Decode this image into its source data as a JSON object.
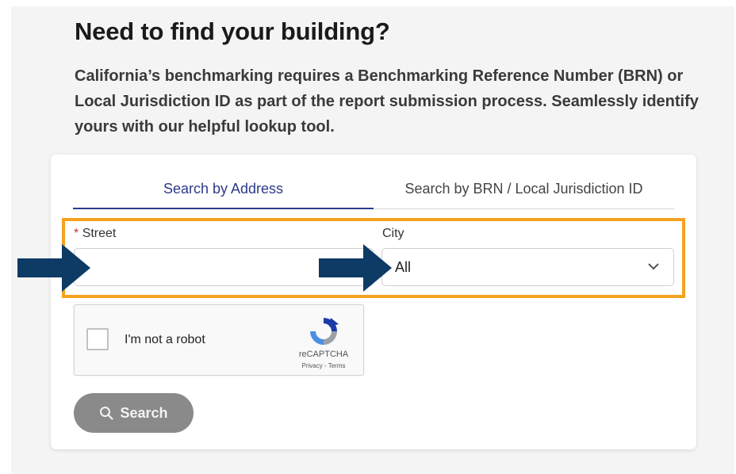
{
  "header": {
    "title": "Need to find your building?",
    "intro": "California’s benchmarking requires a Benchmarking Reference Number (BRN) or Local Jurisdiction ID as part of the report submission process. Seamlessly identify yours with our helpful lookup tool."
  },
  "tabs": [
    {
      "label": "Search by Address",
      "active": true
    },
    {
      "label": "Search by BRN / Local Jurisdiction ID",
      "active": false
    }
  ],
  "form": {
    "street": {
      "required_marker": "*",
      "label": "Street",
      "value": "",
      "placeholder": ""
    },
    "city": {
      "label": "City",
      "selected": "All"
    }
  },
  "recaptcha": {
    "label": "I'm not a robot",
    "brand": "reCAPTCHA",
    "links": "Privacy - Terms"
  },
  "search_button": {
    "label": "Search"
  },
  "colors": {
    "highlight": "#f4a21e",
    "arrow": "#0d3b66",
    "active_tab": "#2c3a8a",
    "button": "#8a8a8a"
  },
  "icons": [
    "arrow-right-icon",
    "chevron-down-icon",
    "recaptcha-logo-icon",
    "search-icon"
  ]
}
